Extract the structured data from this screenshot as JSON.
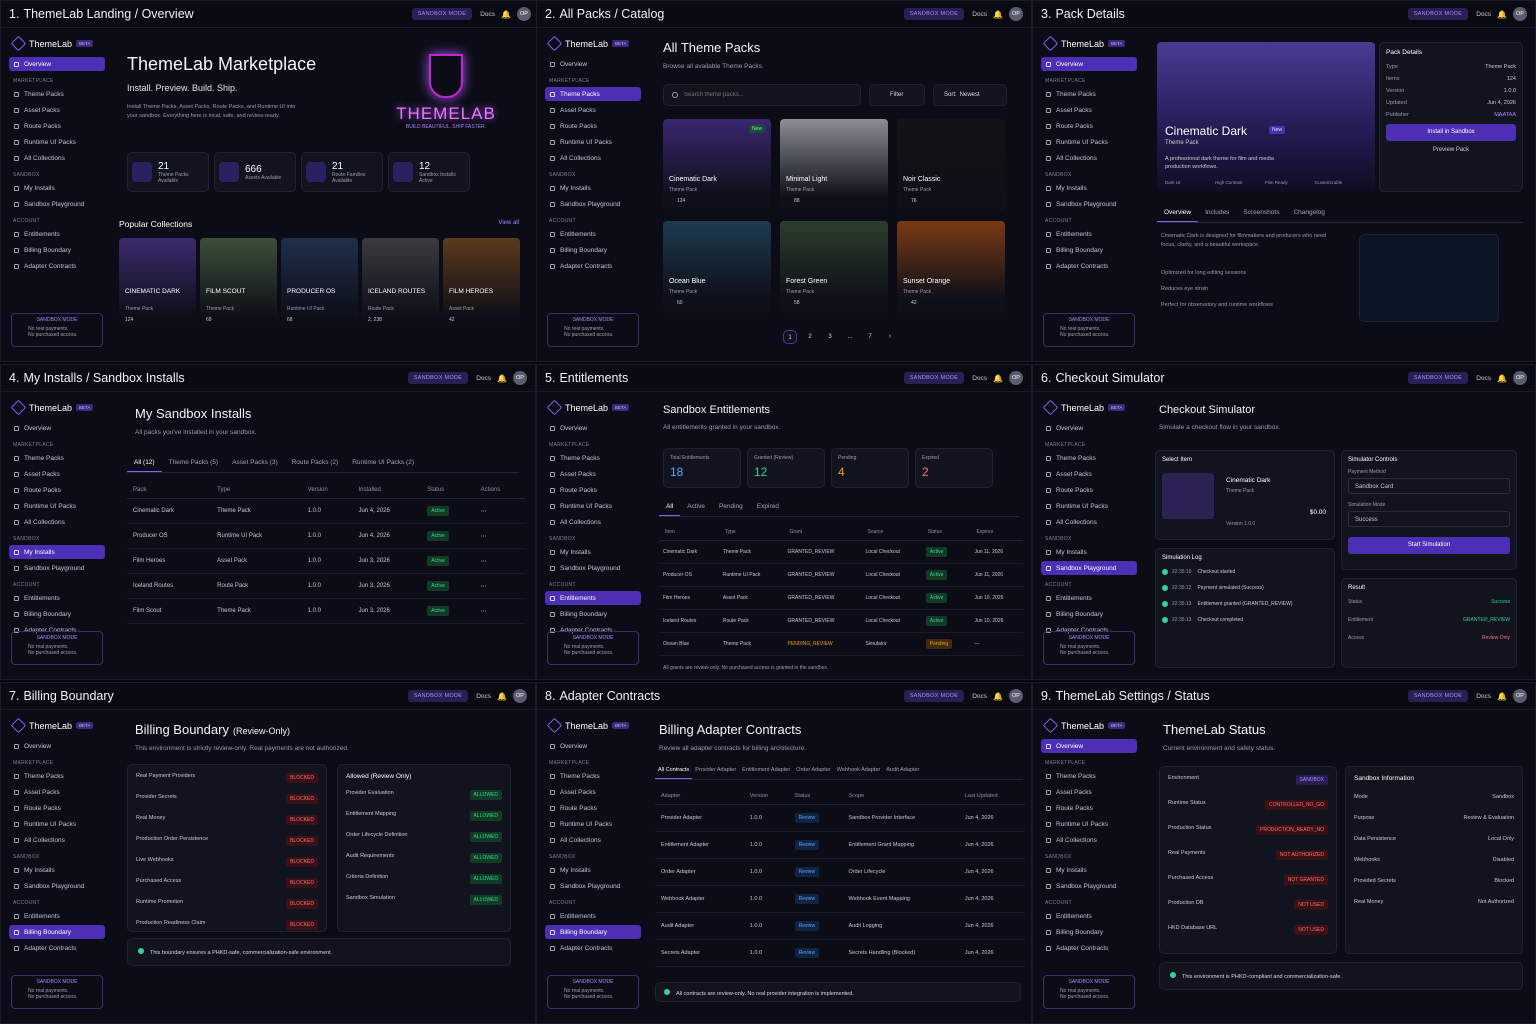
{
  "nav": {
    "brand": "ThemeLab",
    "beta": "BETA",
    "sections": {
      "marketplace": "MARKETPLACE",
      "sandbox": "SANDBOX",
      "account": "ACCOUNT"
    },
    "items": {
      "overview": "Overview",
      "theme_packs": "Theme Packs",
      "asset_packs": "Asset Packs",
      "route_packs": "Route Packs",
      "runtime": "Runtime UI Packs",
      "collections": "All Collections",
      "my_installs": "My Installs",
      "playground": "Sandbox Playground",
      "entitlements": "Entitlements",
      "billing": "Billing Boundary",
      "adapter": "Adapter Contracts"
    },
    "sandbox_box": {
      "title": "SANDBOX MODE",
      "line1": "No real payments.",
      "line2": "No purchased access."
    }
  },
  "header": {
    "sandbox": "SANDBOX MODE",
    "docs": "Docs",
    "avatar": "OP"
  },
  "panels": [
    {
      "num": "1.",
      "title": "ThemeLab Landing / Overview"
    },
    {
      "num": "2.",
      "title": "All Packs / Catalog"
    },
    {
      "num": "3.",
      "title": "Pack Details"
    },
    {
      "num": "4.",
      "title": "My Installs / Sandbox Installs"
    },
    {
      "num": "5.",
      "title": "Entitlements"
    },
    {
      "num": "6.",
      "title": "Checkout Simulator"
    },
    {
      "num": "7.",
      "title": "Billing Boundary"
    },
    {
      "num": "8.",
      "title": "Adapter Contracts"
    },
    {
      "num": "9.",
      "title": "ThemeLab Settings / Status"
    }
  ],
  "p1": {
    "title": "ThemeLab Marketplace",
    "tagline": "Install. Preview. Build. Ship.",
    "desc": "Install Theme Packs, Asset Packs, Route Packs, and Runtime UI into your sandbox. Everything here is local, safe, and review-ready.",
    "hero_word": "THEMELAB",
    "hero_sub": "BUILD BEAUTIFUL. SHIP FASTER.",
    "stats": [
      {
        "n": "21",
        "l": "Theme Packs Available"
      },
      {
        "n": "666",
        "l": "Assets Available"
      },
      {
        "n": "21",
        "l": "Route Families Available"
      },
      {
        "n": "12",
        "l": "Sandbox Installs Active"
      }
    ],
    "popular": "Popular Collections",
    "view_all": "View all",
    "collections": [
      {
        "name": "CINEMATIC DARK",
        "type": "Theme Pack",
        "count": "124"
      },
      {
        "name": "FILM SCOUT",
        "type": "Theme Pack",
        "count": "68"
      },
      {
        "name": "PRODUCER OS",
        "type": "Runtime UI Pack",
        "count": "68"
      },
      {
        "name": "ICELAND ROUTES",
        "type": "Route Pack",
        "count": "2, 238"
      },
      {
        "name": "FILM HEROES",
        "type": "Asset Pack",
        "count": "42"
      }
    ]
  },
  "p2": {
    "title": "All Theme Packs",
    "sub": "Browse all available Theme Packs.",
    "search": "Search theme packs...",
    "filter": "Filter",
    "sort_label": "Sort:",
    "sort": "Newest",
    "cards": [
      {
        "name": "Cinematic Dark",
        "type": "Theme Pack",
        "count": "124",
        "badge": "New"
      },
      {
        "name": "Minimal Light",
        "type": "Theme Pack",
        "count": "88"
      },
      {
        "name": "Noir Classic",
        "type": "Theme Pack",
        "count": "76"
      },
      {
        "name": "Ocean Blue",
        "type": "Theme Pack",
        "count": "60"
      },
      {
        "name": "Forest Green",
        "type": "Theme Pack",
        "count": "58"
      },
      {
        "name": "Sunset Orange",
        "type": "Theme Pack",
        "count": "42"
      }
    ],
    "pages": [
      "1",
      "2",
      "3",
      "...",
      "7"
    ]
  },
  "p3": {
    "title": "Cinematic Dark",
    "badge": "New",
    "type": "Theme Pack",
    "desc": "A professional dark theme for film and media production workflows.",
    "chips": [
      "Dark UI",
      "High Contrast",
      "Film Ready",
      "Customizable"
    ],
    "details_title": "Pack Details",
    "details": [
      [
        "Type",
        "Theme Pack"
      ],
      [
        "Items",
        "124"
      ],
      [
        "Version",
        "1.0.0"
      ],
      [
        "Updated",
        "Jun 4, 2026"
      ],
      [
        "Publisher",
        "MAATAA"
      ]
    ],
    "install": "Install in Sandbox",
    "preview": "Preview Pack",
    "tabs": [
      "Overview",
      "Includes",
      "Screenshots",
      "Changelog"
    ],
    "overview": "Cinematic Dark is designed for filmmakers and producers who need focus, clarity, and a beautiful workspace.",
    "bullets": [
      "Optimized for long editing sessions",
      "Reduces eye strain",
      "Perfect for observatory and runtime workflows"
    ]
  },
  "p4": {
    "title": "My Sandbox Installs",
    "sub": "All packs you've installed in your sandbox.",
    "tabs": [
      "All (12)",
      "Theme Packs (5)",
      "Asset Packs (3)",
      "Route Packs (2)",
      "Runtime UI Packs (2)"
    ],
    "cols": [
      "Pack",
      "Type",
      "Version",
      "Installed",
      "Status",
      "Actions"
    ],
    "rows": [
      [
        "Cinematic Dark",
        "Theme Pack",
        "1.0.0",
        "Jun 4, 2026",
        "Active"
      ],
      [
        "Producer OS",
        "Runtime UI Pack",
        "1.0.0",
        "Jun 4, 2026",
        "Active"
      ],
      [
        "Film Heroes",
        "Asset Pack",
        "1.0.0",
        "Jun 3, 2026",
        "Active"
      ],
      [
        "Iceland Routes",
        "Route Pack",
        "1.0.0",
        "Jun 3, 2026",
        "Active"
      ],
      [
        "Film Scout",
        "Theme Pack",
        "1.0.0",
        "Jun 3, 2026",
        "Active"
      ]
    ]
  },
  "p5": {
    "title": "Sandbox Entitlements",
    "sub": "All entitlements granted in your sandbox.",
    "stats": [
      {
        "l": "Total Entitlements",
        "n": "18"
      },
      {
        "l": "Granted (Review)",
        "n": "12"
      },
      {
        "l": "Pending",
        "n": "4"
      },
      {
        "l": "Expired",
        "n": "2"
      }
    ],
    "tabs": [
      "All",
      "Active",
      "Pending",
      "Expired"
    ],
    "cols": [
      "Item",
      "Type",
      "Grant",
      "Source",
      "Status",
      "Expires"
    ],
    "rows": [
      [
        "Cinematic Dark",
        "Theme Pack",
        "GRANTED_REVIEW",
        "Local Checkout",
        "Active",
        "Jun 11, 2026"
      ],
      [
        "Producer OS",
        "Runtime UI Pack",
        "GRANTED_REVIEW",
        "Local Checkout",
        "Active",
        "Jun 11, 2026"
      ],
      [
        "Film Heroes",
        "Asset Pack",
        "GRANTED_REVIEW",
        "Local Checkout",
        "Active",
        "Jun 10, 2026"
      ],
      [
        "Iceland Routes",
        "Route Pack",
        "GRANTED_REVIEW",
        "Local Checkout",
        "Active",
        "Jun 10, 2026"
      ],
      [
        "Ocean Blue",
        "Theme Pack",
        "PENDING_REVIEW",
        "Simulator",
        "Pending",
        "—"
      ]
    ],
    "note": "All grants are review-only. No purchased access is granted in the sandbox."
  },
  "p6": {
    "title": "Checkout Simulator",
    "sub": "Simulate a checkout flow in your sandbox.",
    "select": "Select Item",
    "item": "Cinematic Dark",
    "item_type": "Theme Pack",
    "version": "Version 1.0.0",
    "price": "$0.00",
    "controls": "Simulator Controls",
    "pm_label": "Payment Method",
    "pm": "Sandbox Card",
    "mode_label": "Simulation Mode",
    "mode": "Success",
    "start": "Start Simulation",
    "log_title": "Simulation Log",
    "log": [
      [
        "22:35:10",
        "Checkout started"
      ],
      [
        "22:35:12",
        "Payment simulated (Success)"
      ],
      [
        "22:35:13",
        "Entitlement granted (GRANTED_REVIEW)"
      ],
      [
        "22:35:13",
        "Checkout completed"
      ]
    ],
    "result": "Result",
    "res": [
      [
        "Status",
        "Success"
      ],
      [
        "Entitlement",
        "GRANTED_REVIEW"
      ],
      [
        "Access",
        "Review Only"
      ]
    ]
  },
  "p7": {
    "title": "Billing Boundary",
    "title2": "(Review-Only)",
    "sub": "This environment is strictly review-only. Real payments are not authorized.",
    "blocked": [
      "Real Payment Providers",
      "Provider Secrets",
      "Real Money",
      "Production Order Persistence",
      "Live Webhooks",
      "Purchased Access",
      "Runtime Promotion",
      "Production Readiness Claim"
    ],
    "allowed_title": "Allowed (Review Only)",
    "allowed": [
      "Provider Evaluation",
      "Entitlement Mapping",
      "Order Lifecycle Definition",
      "Audit Requirements",
      "Criteria Definition",
      "Sandbox Simulation"
    ],
    "blocked_tag": "BLOCKED",
    "allowed_tag": "ALLOWED",
    "note": "This boundary ensures a PHKD-safe, commercialization-safe environment."
  },
  "p8": {
    "title": "Billing Adapter Contracts",
    "sub": "Review all adapter contracts for billing architecture.",
    "tabs": [
      "All Contracts",
      "Provider Adapter",
      "Entitlement Adapter",
      "Order Adapter",
      "Webhook Adapter",
      "Audit Adapter"
    ],
    "cols": [
      "Adapter",
      "Version",
      "Status",
      "Scope",
      "Last Updated"
    ],
    "rows": [
      [
        "Provider Adapter",
        "1.0.0",
        "Review",
        "Sandbox Provider Interface",
        "Jun 4, 2026"
      ],
      [
        "Entitlement Adapter",
        "1.0.0",
        "Review",
        "Entitlement Grant Mapping",
        "Jun 4, 2026"
      ],
      [
        "Order Adapter",
        "1.0.0",
        "Review",
        "Order Lifecycle",
        "Jun 4, 2026"
      ],
      [
        "Webhook Adapter",
        "1.0.0",
        "Review",
        "Webhook Event Mapping",
        "Jun 4, 2026"
      ],
      [
        "Audit Adapter",
        "1.0.0",
        "Review",
        "Audit Logging",
        "Jun 4, 2026"
      ],
      [
        "Secrets Adapter",
        "1.0.0",
        "Review",
        "Secrets Handling (Blocked)",
        "Jun 4, 2026"
      ]
    ],
    "note": "All contracts are review-only. No real provider integration is implemented."
  },
  "p9": {
    "title": "ThemeLab Status",
    "sub": "Current environment and safety status.",
    "status": [
      [
        "Environment",
        "SANDBOX"
      ],
      [
        "Runtime Status",
        "CONTROLLED_NO_GO"
      ],
      [
        "Production Status",
        "PRODUCTION_READY_NO"
      ],
      [
        "Real Payments",
        "NOT AUTHORIZED"
      ],
      [
        "Purchased Access",
        "NOT GRANTED"
      ],
      [
        "Production DB",
        "NOT USED"
      ],
      [
        "HKD Database URL",
        "NOT USED"
      ]
    ],
    "info_title": "Sandbox Information",
    "info": [
      [
        "Mode",
        "Sandbox"
      ],
      [
        "Purpose",
        "Review & Evaluation"
      ],
      [
        "Data Persistence",
        "Local Only"
      ],
      [
        "Webhooks",
        "Disabled"
      ],
      [
        "Provided Secrets",
        "Blocked"
      ],
      [
        "Real Money",
        "Not Authorized"
      ]
    ],
    "note": "This environment is PHKD-compliant and commercialization-safe."
  },
  "colors": {
    "accent": "#8b5cf6",
    "active": "#4c2fb4",
    "green": "#34d399",
    "red": "#f87171",
    "orange": "#f59e0b"
  }
}
